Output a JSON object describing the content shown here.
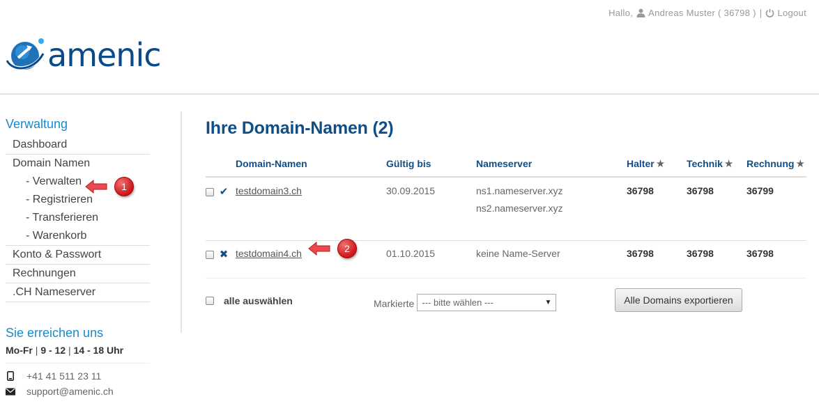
{
  "topbar": {
    "greeting": "Hallo,",
    "user": "Andreas Muster ( 36798 )",
    "separator": "|",
    "logout": "Logout"
  },
  "brand": {
    "name": "amenic"
  },
  "sidebar": {
    "section_title": "Verwaltung",
    "items": [
      {
        "label": "Dashboard"
      },
      {
        "label": "Domain Namen"
      },
      {
        "label": "Konto & Passwort"
      },
      {
        "label": "Rechnungen"
      },
      {
        "label": ".CH Nameserver"
      }
    ],
    "domain_children": [
      {
        "label": "- Verwalten"
      },
      {
        "label": "- Registrieren"
      },
      {
        "label": "- Transferieren"
      },
      {
        "label": "- Warenkorb"
      }
    ],
    "contact_title": "Sie erreichen uns",
    "hours": {
      "days": "Mo-Fr",
      "slot1": "9 - 12",
      "slot2": "14 - 18 Uhr",
      "pipe": "|"
    },
    "phone": "+41 41 511 23 11",
    "email": "support@amenic.ch"
  },
  "main": {
    "title": "Ihre Domain-Namen (2)",
    "columns": {
      "domain": "Domain-Namen",
      "valid": "Gültig bis",
      "ns": "Nameserver",
      "holder": "Halter",
      "tech": "Technik",
      "billing": "Rechnung"
    },
    "rows": [
      {
        "status": "✔",
        "domain": "testdomain3.ch",
        "valid": "30.09.2015",
        "ns1": "ns1.nameserver.xyz",
        "ns2": "ns2.nameserver.xyz",
        "holder": "36798",
        "tech": "36798",
        "billing": "36799"
      },
      {
        "status": "✖",
        "domain": "testdomain4.ch",
        "valid": "01.10.2015",
        "ns1": "keine Name-Server",
        "ns2": "",
        "holder": "36798",
        "tech": "36798",
        "billing": "36798"
      }
    ],
    "select_all": "alle auswählen",
    "marked_label": "Markierte",
    "marked_select": "--- bitte wählen ---",
    "export_button": "Alle Domains exportieren"
  },
  "callouts": {
    "one": "1",
    "two": "2"
  },
  "colors": {
    "brand": "#0a4a8a",
    "accent": "#1a8acb",
    "heading": "#0f4e86",
    "callout": "#c9171b"
  }
}
